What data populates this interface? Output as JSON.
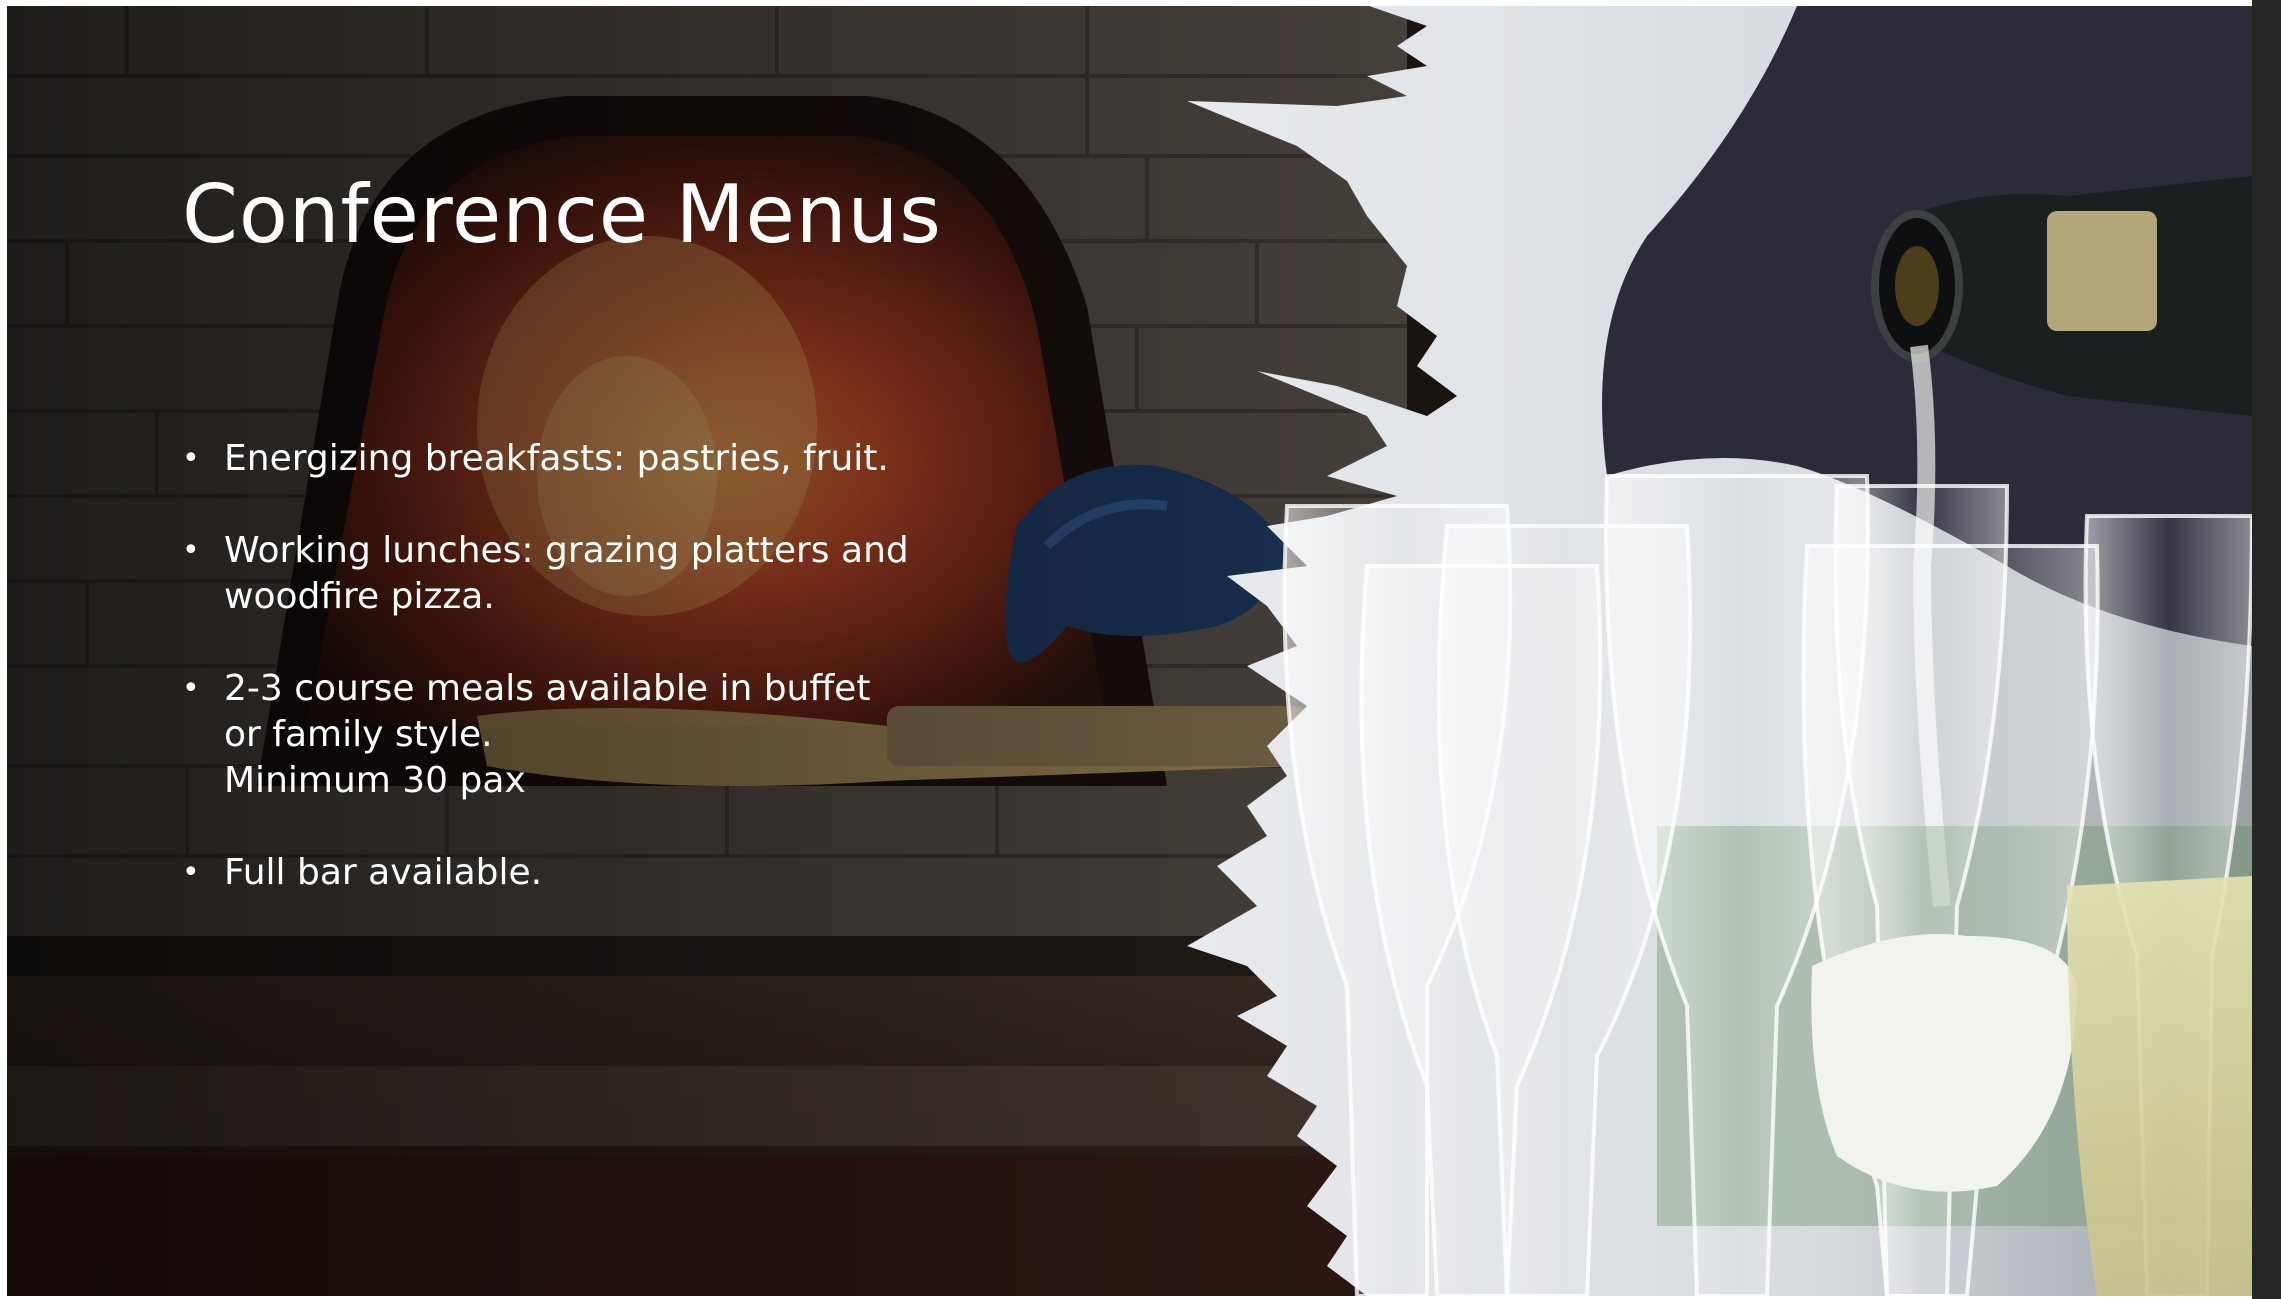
{
  "slide": {
    "title": "Conference Menus",
    "bullets": [
      {
        "lines": [
          "Energizing breakfasts: pastries, fruit."
        ]
      },
      {
        "lines": [
          "Working lunches: grazing platters and",
          "woodfire pizza."
        ]
      },
      {
        "lines": [
          "2-3 course meals available in buffet",
          "or family style.",
          "Minimum 30 pax"
        ]
      },
      {
        "lines": [
          "Full bar available."
        ]
      }
    ],
    "bullet_glyph": "•"
  },
  "images": {
    "left": "woodfire-oven-pizza-photo",
    "right": "champagne-pouring-glasses-photo"
  },
  "colors": {
    "title": "#ffffff",
    "text": "#ffffff",
    "fire": "#d9622a"
  }
}
